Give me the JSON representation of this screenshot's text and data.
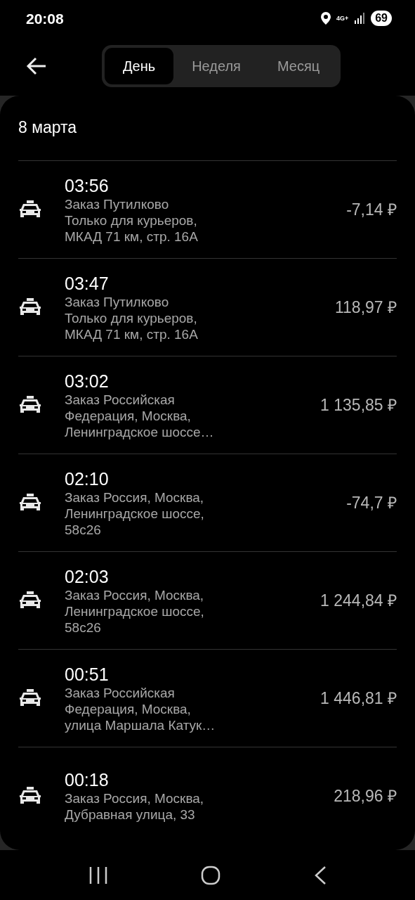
{
  "status_bar": {
    "time": "20:08",
    "network": "4G+",
    "battery": "69"
  },
  "tabs": [
    {
      "label": "День",
      "selected": true
    },
    {
      "label": "Неделя",
      "selected": false
    },
    {
      "label": "Месяц",
      "selected": false
    }
  ],
  "date_heading": "8 марта",
  "orders": [
    {
      "time": "03:56",
      "lines": [
        "Заказ Путилково",
        "Только для курьеров,",
        "МКАД 71 км, стр. 16А"
      ],
      "amount": "-7,14 ₽"
    },
    {
      "time": "03:47",
      "lines": [
        "Заказ Путилково",
        "Только для курьеров,",
        "МКАД 71 км, стр. 16А"
      ],
      "amount": "118,97 ₽"
    },
    {
      "time": "03:02",
      "lines": [
        "Заказ Российская",
        "Федерация, Москва,",
        "Ленинградское шоссе…"
      ],
      "amount": "1 135,85 ₽"
    },
    {
      "time": "02:10",
      "lines": [
        "Заказ Россия, Москва,",
        "Ленинградское шоссе,",
        "58с26"
      ],
      "amount": "-74,7 ₽"
    },
    {
      "time": "02:03",
      "lines": [
        "Заказ Россия, Москва,",
        "Ленинградское шоссе,",
        "58с26"
      ],
      "amount": "1 244,84 ₽"
    },
    {
      "time": "00:51",
      "lines": [
        "Заказ Российская",
        "Федерация, Москва,",
        "улица Маршала Катук…"
      ],
      "amount": "1 446,81 ₽"
    },
    {
      "time": "00:18",
      "lines": [
        "Заказ Россия, Москва,",
        "Дубравная улица, 33"
      ],
      "amount": "218,96 ₽"
    }
  ]
}
